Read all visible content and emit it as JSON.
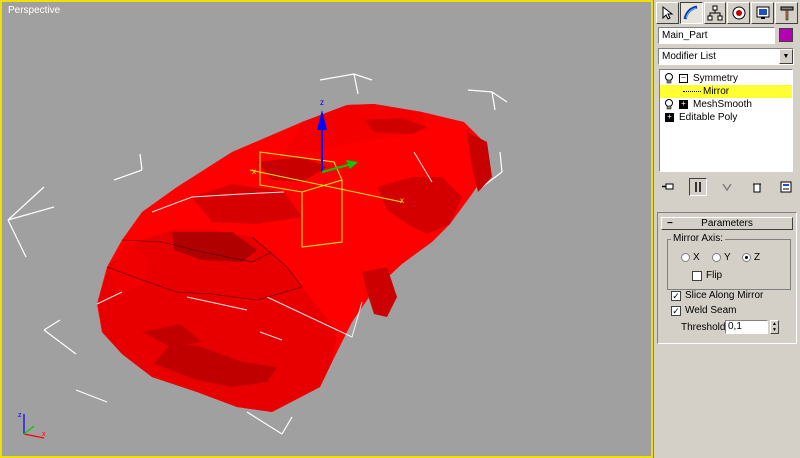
{
  "viewport": {
    "label": "Perspective",
    "active_border": "#f0e000",
    "background": "#a0a0a0",
    "model_color": "#ff0000"
  },
  "command_panel": {
    "tabs": [
      "create-icon",
      "modify-icon",
      "hierarchy-icon",
      "motion-icon",
      "display-icon",
      "utilities-icon"
    ],
    "object_name": "Main_Part",
    "object_color": "#b200b2",
    "modifier_list": "Modifier List",
    "stack": [
      {
        "label": "Symmetry"
      },
      {
        "label": "Mirror"
      },
      {
        "label": "MeshSmooth"
      },
      {
        "label": "Editable Poly"
      }
    ],
    "parameters": {
      "title": "Parameters",
      "mirror_axis_label": "Mirror Axis:",
      "axis_x": "X",
      "axis_y": "Y",
      "axis_z": "Z",
      "selected_axis": "Z",
      "flip_label": "Flip",
      "flip_checked": false,
      "slice_label": "Slice Along Mirror",
      "slice_checked": true,
      "weld_label": "Weld Seam",
      "weld_checked": true,
      "threshold_label": "Threshold:",
      "threshold_value": "0,1"
    }
  }
}
